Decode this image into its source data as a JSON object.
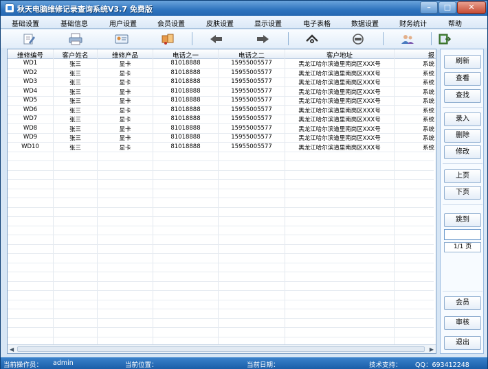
{
  "window": {
    "title": "秋天电脑维修记录查询系统V3.7 免费版"
  },
  "menu": [
    "基础设置",
    "基础信息",
    "用户设置",
    "会员设置",
    "皮肤设置",
    "显示设置",
    "电子表格",
    "数据设置",
    "财务统计",
    "帮助"
  ],
  "toolbar": [
    "edit-icon",
    "printer-icon",
    "card-icon",
    "export-icon",
    "arrow-left-icon",
    "arrow-right-icon",
    "network-icon",
    "refresh-icon",
    "users-icon",
    "exit-icon"
  ],
  "table": {
    "columns": [
      "维修编号",
      "客户姓名",
      "维修产品",
      "电话之一",
      "电话之二",
      "客户地址",
      "报"
    ],
    "rows": [
      [
        "WD1",
        "张三",
        "显卡",
        "81018888",
        "15955005577",
        "黑龙江哈尔滨道里南岗区XXX号",
        "系统"
      ],
      [
        "WD2",
        "张三",
        "显卡",
        "81018888",
        "15955005577",
        "黑龙江哈尔滨道里南岗区XXX号",
        "系统"
      ],
      [
        "WD3",
        "张三",
        "显卡",
        "81018888",
        "15955005577",
        "黑龙江哈尔滨道里南岗区XXX号",
        "系统"
      ],
      [
        "WD4",
        "张三",
        "显卡",
        "81018888",
        "15955005577",
        "黑龙江哈尔滨道里南岗区XXX号",
        "系统"
      ],
      [
        "WD5",
        "张三",
        "显卡",
        "81018888",
        "15955005577",
        "黑龙江哈尔滨道里南岗区XXX号",
        "系统"
      ],
      [
        "WD6",
        "张三",
        "显卡",
        "81018888",
        "15955005577",
        "黑龙江哈尔滨道里南岗区XXX号",
        "系统"
      ],
      [
        "WD7",
        "张三",
        "显卡",
        "81018888",
        "15955005577",
        "黑龙江哈尔滨道里南岗区XXX号",
        "系统"
      ],
      [
        "WD8",
        "张三",
        "显卡",
        "81018888",
        "15955005577",
        "黑龙江哈尔滨道里南岗区XXX号",
        "系统"
      ],
      [
        "WD9",
        "张三",
        "显卡",
        "81018888",
        "15955005577",
        "黑龙江哈尔滨道里南岗区XXX号",
        "系统"
      ],
      [
        "WD10",
        "张三",
        "显卡",
        "81018888",
        "15955005577",
        "黑龙江哈尔滨道里南岗区XXX号",
        "系统"
      ]
    ]
  },
  "side": {
    "refresh": "刷新",
    "view": "查看",
    "find": "查找",
    "add": "录入",
    "delete": "删除",
    "modify": "修改",
    "prev": "上页",
    "next": "下页",
    "jump": "跳到",
    "jump_value": "",
    "page": "1/1 页",
    "member": "会员",
    "audit": "审核",
    "exit": "退出"
  },
  "status": {
    "operator_label": "当前操作员：",
    "operator": "admin",
    "location_label": "当前位置：",
    "date_label": "当前日期：",
    "support_label": "技术支持：",
    "qq": "QQ：693412248"
  }
}
